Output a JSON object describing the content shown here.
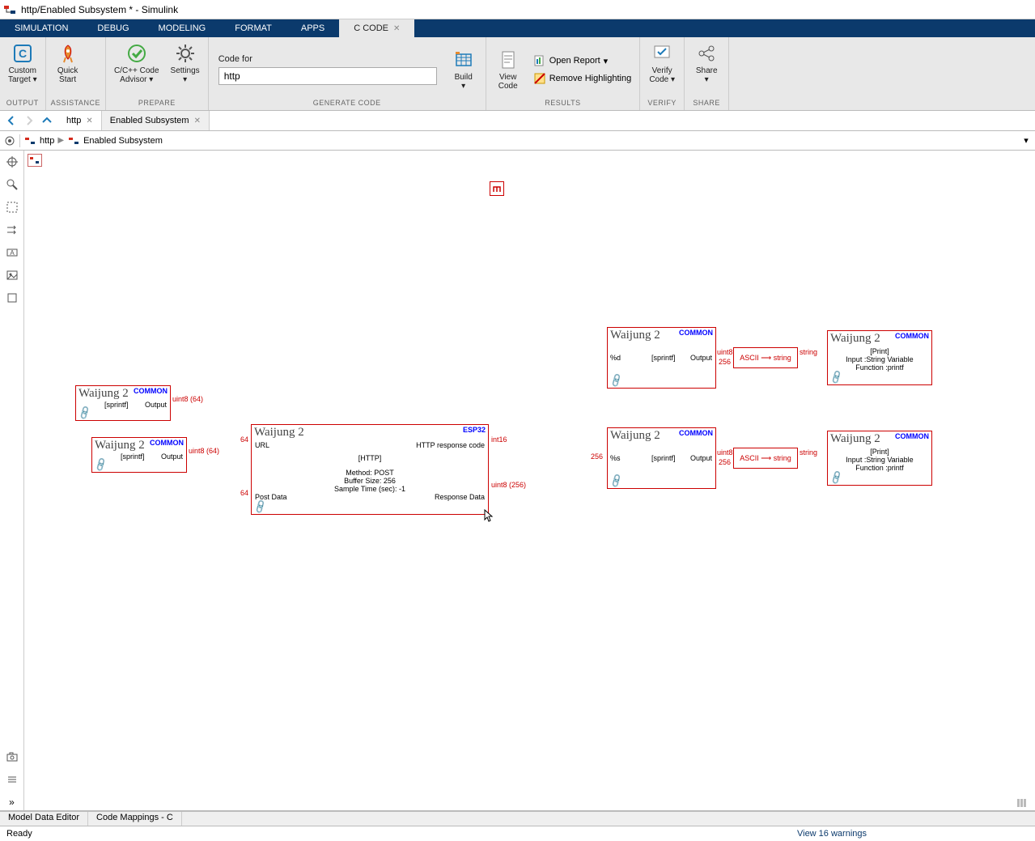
{
  "title": "http/Enabled Subsystem * - Simulink",
  "toolstrip_tabs": [
    "SIMULATION",
    "DEBUG",
    "MODELING",
    "FORMAT",
    "APPS",
    "C CODE"
  ],
  "ribbon": {
    "output": {
      "label": "OUTPUT",
      "custom_target": "Custom\nTarget ▾"
    },
    "assistance": {
      "label": "ASSISTANCE",
      "quick_start": "Quick\nStart"
    },
    "prepare": {
      "label": "PREPARE",
      "advisor": "C/C++ Code\nAdvisor ▾",
      "settings": "Settings\n▾"
    },
    "generate": {
      "label": "GENERATE CODE",
      "code_for": "Code for",
      "code_for_value": "http",
      "build": "Build\n▾"
    },
    "results": {
      "label": "RESULTS",
      "view_code": "View\nCode",
      "open_report": "Open Report",
      "remove_hl": "Remove Highlighting"
    },
    "verify": {
      "label": "VERIFY",
      "verify": "Verify\nCode ▾"
    },
    "share": {
      "label": "SHARE",
      "share": "Share\n▾"
    }
  },
  "doc_tabs": {
    "tab1": "http",
    "tab2": "Enabled Subsystem"
  },
  "breadcrumb": {
    "root": "http",
    "sub": "Enabled Subsystem"
  },
  "blocks": {
    "sprintf1": {
      "title": "Waijung 2",
      "tag": "COMMON",
      "mid": "[sprintf]",
      "out": "Output"
    },
    "sprintf2": {
      "title": "Waijung 2",
      "tag": "COMMON",
      "mid": "[sprintf]",
      "out": "Output"
    },
    "http": {
      "title": "Waijung 2",
      "tag": "ESP32",
      "url": "URL",
      "post": "Post Data",
      "httpcode": "HTTP response code",
      "respdata": "Response Data",
      "name": "[HTTP]",
      "line1": "Method: POST",
      "line2": "Buffer Size: 256",
      "line3": "Sample Time (sec): -1"
    },
    "sprintf3": {
      "title": "Waijung 2",
      "tag": "COMMON",
      "in": "%d",
      "mid": "[sprintf]",
      "out": "Output"
    },
    "sprintf4": {
      "title": "Waijung 2",
      "tag": "COMMON",
      "in": "%s",
      "mid": "[sprintf]",
      "out": "Output"
    },
    "ascii1": "ASCII ⟶ string",
    "ascii2": "ASCII ⟶ string",
    "print1": {
      "title": "Waijung 2",
      "tag": "COMMON",
      "name": "[Print]",
      "line1": "Input :String Variable",
      "line2": "Function :printf"
    },
    "print2": {
      "title": "Waijung 2",
      "tag": "COMMON",
      "name": "[Print]",
      "line1": "Input :String Variable",
      "line2": "Function :printf"
    }
  },
  "wire_labels": {
    "l1": "uint8 (64)",
    "l1n": "64",
    "l2": "uint8 (64)",
    "l2n": "64",
    "l3": "int16",
    "l4": "uint8 (256)",
    "l4n": "256",
    "l5": "uint8",
    "l5n": "256",
    "l6": "string",
    "l7": "uint8",
    "l7n": "256",
    "l8": "string"
  },
  "bottom_tabs": {
    "t1": "Model Data Editor",
    "t2": "Code Mappings - C"
  },
  "status": {
    "ready": "Ready",
    "warnings": "View 16 warnings"
  }
}
